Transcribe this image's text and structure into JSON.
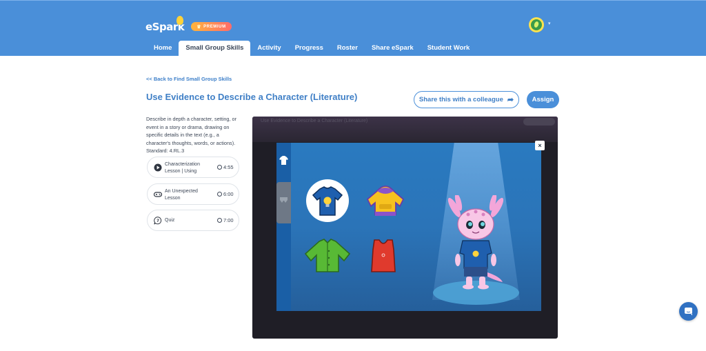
{
  "header": {
    "logo": "eSpark",
    "premium_badge": "PREMIUM",
    "nav": [
      {
        "label": "Home"
      },
      {
        "label": "Small Group Skills",
        "active": true
      },
      {
        "label": "Activity"
      },
      {
        "label": "Progress"
      },
      {
        "label": "Roster"
      },
      {
        "label": "Share eSpark"
      },
      {
        "label": "Student Work"
      }
    ]
  },
  "page": {
    "back_link": "<< Back to Find Small Group Skills",
    "title": "Use Evidence to Describe a Character (Literature)",
    "share_button": "Share this with a colleague",
    "assign_button": "Assign",
    "description": "Describe in depth a character, setting, or event in a story or drama, drawing on specific details in the text (e.g., a character's thoughts, words, or actions). Standard: 4.RL.3",
    "lessons": [
      {
        "name": "Characterization Lesson | Using",
        "duration": "4:55",
        "icon": "play-circle-icon"
      },
      {
        "name": "An Unexpected Lesson",
        "duration": "6:00",
        "icon": "game-controller-icon"
      },
      {
        "name": "Quiz",
        "duration": "7:00",
        "icon": "quiz-bubble-icon"
      }
    ]
  },
  "player": {
    "strip_text": "Use Evidence to Describe a Character (Literature)",
    "close_label": "×",
    "categories": [
      "shirt-icon",
      "pants-icon"
    ],
    "items": [
      {
        "name": "blue-lightbulb-tshirt",
        "selected": true
      },
      {
        "name": "yellow-purple-hoodie",
        "selected": false
      },
      {
        "name": "green-button-shirt",
        "selected": false
      },
      {
        "name": "red-tank-top",
        "selected": false
      }
    ]
  },
  "colors": {
    "header_blue": "#4a8fd9",
    "accent": "#3f7fc6",
    "stage_blue": "#2b74b8"
  }
}
